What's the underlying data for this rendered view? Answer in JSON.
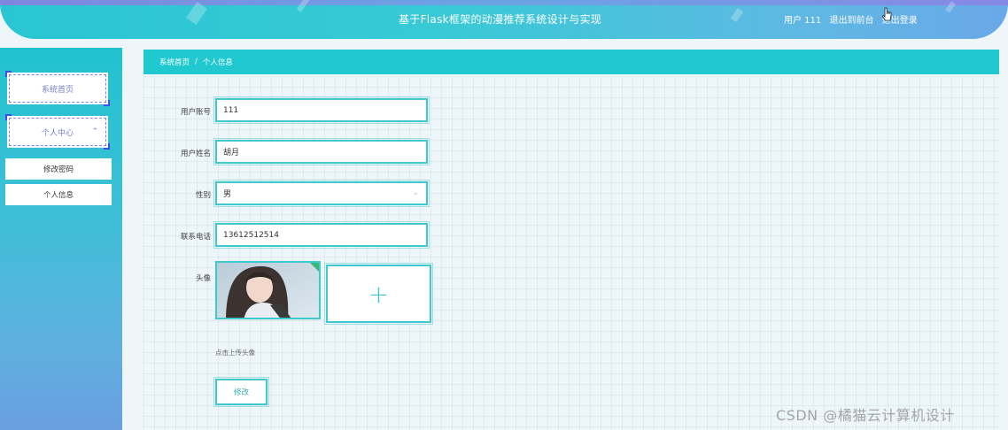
{
  "header": {
    "title": "基于Flask框架的动漫推荐系统设计与实现",
    "user_label": "用户 111",
    "back_label": "退出到前台",
    "logout_label": "退出登录"
  },
  "sidebar": {
    "items": [
      {
        "label": "系统首页"
      },
      {
        "label": "个人中心"
      }
    ],
    "sub_items": [
      {
        "label": "修改密码"
      },
      {
        "label": "个人信息"
      }
    ]
  },
  "breadcrumb": {
    "home": "系统首页",
    "separator": "/",
    "current": "个人信息"
  },
  "form": {
    "account_label": "用户账号",
    "account_value": "111",
    "name_label": "用户姓名",
    "name_value": "胡月",
    "gender_label": "性别",
    "gender_value": "男",
    "phone_label": "联系电话",
    "phone_value": "13612512514",
    "avatar_label": "头像",
    "upload_plus": "+",
    "upload_hint": "点击上传头像",
    "submit_label": "修改"
  },
  "colors": {
    "accent": "#20c9d0",
    "sidebar_top": "#21c2cf",
    "sidebar_bottom": "#6a9fe0",
    "menu_border": "#3d4fe8"
  },
  "watermark": "CSDN @橘猫云计算机设计"
}
